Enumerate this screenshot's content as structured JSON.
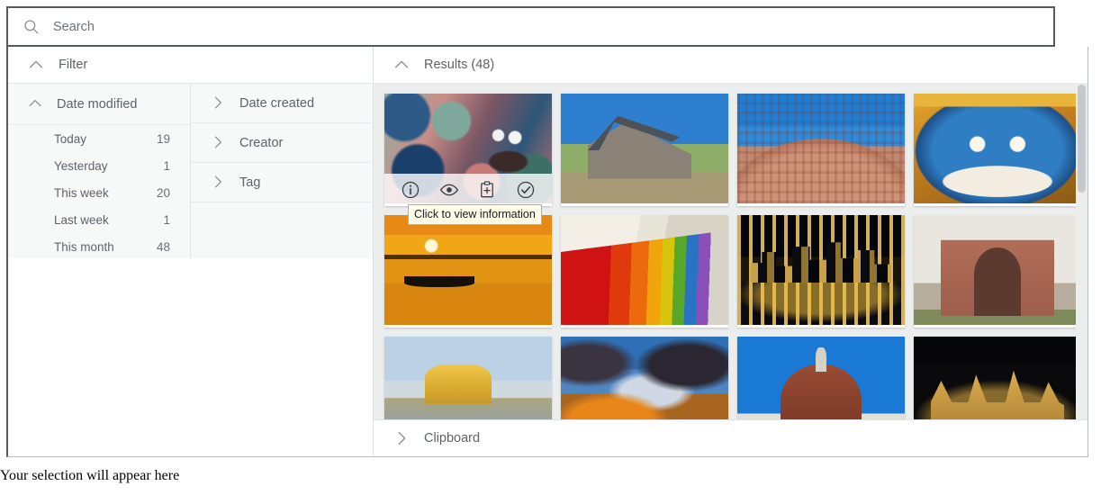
{
  "search": {
    "placeholder": "Search",
    "value": "",
    "icon": "search-icon"
  },
  "filter": {
    "header_label": "Filter",
    "header_icon": "chevron-up-icon",
    "groups": [
      {
        "label": "Date modified",
        "icon": "chevron-up-icon",
        "expanded": true,
        "facets": [
          {
            "label": "Today",
            "count": "19"
          },
          {
            "label": "Yesterday",
            "count": "1"
          },
          {
            "label": "This week",
            "count": "20"
          },
          {
            "label": "Last week",
            "count": "1"
          },
          {
            "label": "This month",
            "count": "48"
          }
        ]
      },
      {
        "label": "Date created",
        "icon": "chevron-right-icon",
        "expanded": false,
        "facets": []
      },
      {
        "label": "Creator",
        "icon": "chevron-right-icon",
        "expanded": false,
        "facets": []
      },
      {
        "label": "Tag",
        "icon": "chevron-right-icon",
        "expanded": false,
        "facets": []
      }
    ]
  },
  "results": {
    "header_label": "Results (48)",
    "header_icon": "chevron-up-icon",
    "count": 48,
    "columns": 4,
    "hovered_index": 0,
    "overlay_actions": [
      {
        "name": "info-icon",
        "title": "Click to view information"
      },
      {
        "name": "eye-icon",
        "title": "Preview"
      },
      {
        "name": "clipboard-add-icon",
        "title": "Add to clipboard"
      },
      {
        "name": "check-circle-icon",
        "title": "Select"
      }
    ],
    "tooltip": "Click to view information",
    "items": [
      {
        "alt": "Colorful Balinese mural with mythical creature",
        "art": "art-mural"
      },
      {
        "alt": "Stone church on grassy hillside under blue sky",
        "art": "art-church"
      },
      {
        "alt": "Hawa Mahal palace facade in Jaipur",
        "art": "art-palace"
      },
      {
        "alt": "Blue Thai giant demon guardian mask",
        "art": "art-mask"
      },
      {
        "alt": "Rowing boats on river at orange sunset",
        "art": "art-sunset-boat"
      },
      {
        "alt": "Row of rainbow-colored beach huts",
        "art": "art-huts"
      },
      {
        "alt": "City skyline at night reflected in water",
        "art": "art-city-night"
      },
      {
        "alt": "Great Gate of the Taj Mahal",
        "art": "art-gate"
      },
      {
        "alt": "Golden Temple Amritsar reflected in pool",
        "art": "art-golden-temple"
      },
      {
        "alt": "Dramatic storm clouds at sunset",
        "art": "art-storm"
      },
      {
        "alt": "Florence Duomo dome against blue sky",
        "art": "art-duomo"
      },
      {
        "alt": "Illuminated medieval castle at night",
        "art": "art-castle"
      }
    ]
  },
  "clipboard": {
    "label": "Clipboard",
    "icon": "chevron-right-icon",
    "expanded": false
  },
  "caption": "Your selection will appear here",
  "colors": {
    "panel_background": "#f7f8f8",
    "results_background": "#eceded",
    "text": "#5d636a",
    "icon": "#8d9196",
    "border_strong": "#555b60",
    "border_light": "#dcdfe2",
    "tooltip_background": "#fffce9"
  }
}
